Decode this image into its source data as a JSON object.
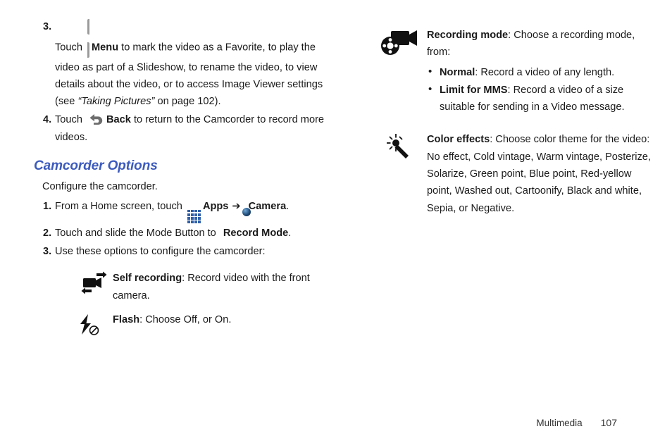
{
  "document": {
    "footer": {
      "section": "Multimedia",
      "page_number": "107"
    }
  },
  "left_column": {
    "steps": [
      {
        "number": "3.",
        "pre_icon_text": "Touch ",
        "icon": "menu-key-icon",
        "bold_label": "Menu",
        "text_a": " to mark the video as a Favorite, to play the video as part of a Slideshow, to rename the video, to view details about the video, or to access Image Viewer settings (see ",
        "italic_ref": "“Taking Pictures”",
        "text_b": " on page 102)."
      },
      {
        "number": "4.",
        "pre_icon_text": "Touch ",
        "icon": "back-arrow-icon",
        "bold_label": "Back",
        "text_a": " to return to the Camcorder to record more videos.",
        "italic_ref": "",
        "text_b": ""
      }
    ],
    "section_heading": "Camcorder Options",
    "intro": "Configure the camcorder.",
    "numbered": [
      {
        "number": "1.",
        "part1": "From a Home screen, touch ",
        "icon1": "apps-grid-icon",
        "bold1": "Apps",
        "arrow": "➔",
        "icon2": "camera-lens-icon",
        "bold2": "Camera",
        "tail": "."
      },
      {
        "number": "2.",
        "part1": "Touch and slide the Mode Button to ",
        "icon1": "record-mode-icon",
        "bold1": "",
        "arrow": "",
        "icon2": "",
        "bold2": "Record Mode",
        "tail": "."
      },
      {
        "number": "3.",
        "part1": "Use these options to configure the camcorder:",
        "icon1": "",
        "bold1": "",
        "arrow": "",
        "icon2": "",
        "bold2": "",
        "tail": ""
      }
    ],
    "options": [
      {
        "icon": "self-recording-icon",
        "label": "Self recording",
        "text": ": Record video with the front camera."
      },
      {
        "icon": "flash-off-icon",
        "label": "Flash",
        "text": ": Choose Off, or On."
      }
    ]
  },
  "right_column": {
    "options": [
      {
        "icon": "recording-mode-film-camera-icon",
        "label": "Recording mode",
        "text": ": Choose a recording mode, from:",
        "bullets": [
          {
            "label": "Normal",
            "text": ": Record a video of any length."
          },
          {
            "label": "Limit for MMS",
            "text": ": Record a video of a size suitable for sending in a Video message."
          }
        ]
      },
      {
        "icon": "color-effects-wand-icon",
        "label": "Color effects",
        "text": ": Choose color theme for the video: No effect, Cold vintage, Warm vintage, Posterize, Solarize, Green point, Blue point, Red-yellow point, Washed out, Cartoonify, Black and white, Sepia, or Negative.",
        "bullets": []
      }
    ]
  },
  "colors": {
    "heading_blue": "#3c5bbd",
    "body_text": "#1a1a1a",
    "apps_icon_blue": "#2f5fa8"
  }
}
